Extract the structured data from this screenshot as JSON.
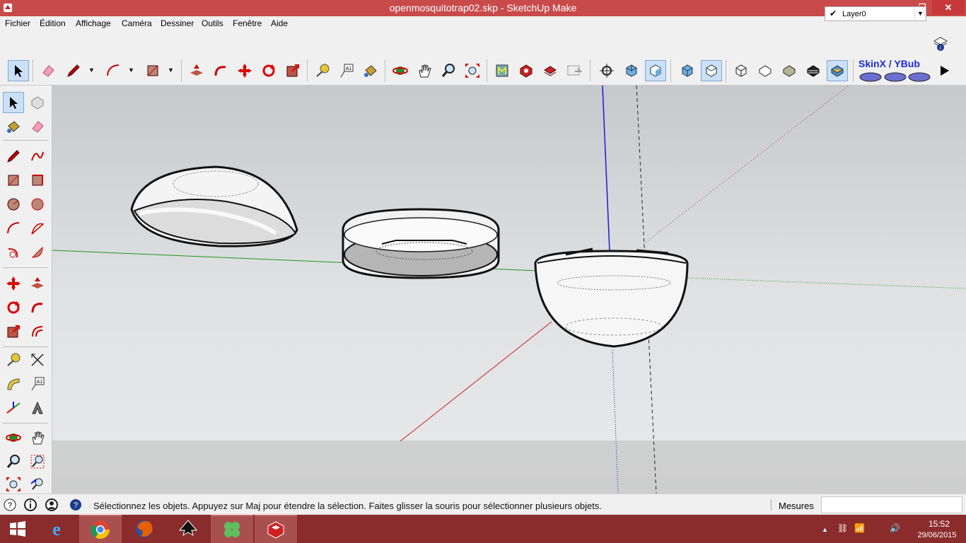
{
  "window": {
    "title": "openmosquitotrap02.skp - SketchUp Make",
    "controls": {
      "minimize": "—",
      "maximize": "❐",
      "close": "✕"
    }
  },
  "menu": [
    "Fichier",
    "Édition",
    "Affichage",
    "Caméra",
    "Dessiner",
    "Outils",
    "Fenêtre",
    "Aide"
  ],
  "layer": {
    "checked": "✔",
    "current": "Layer0"
  },
  "toolbar": {
    "plugin_label": "SkinX / YBub",
    "icons": [
      "select-icon",
      "eraser-icon",
      "pencil-icon",
      "arc-icon",
      "rectangle-icon",
      "push-pull-icon",
      "follow-me-icon",
      "move-icon",
      "rotate-icon",
      "scale-icon",
      "tape-measure-icon",
      "text-label-icon",
      "paint-bucket-icon",
      "orbit-icon",
      "pan-icon",
      "zoom-icon",
      "zoom-extents-icon",
      "warehouse-icon",
      "extension-icon",
      "model-share-icon",
      "preview-icon",
      "position-camera-icon",
      "walk-icon",
      "look-around-icon",
      "iso-view-icon",
      "top-view-icon",
      "xray-icon",
      "wireframe-icon",
      "hidden-line-icon",
      "shaded-icon",
      "shaded-textures-icon",
      "monochrome-icon",
      "skinx-icon",
      "ybub-icon",
      "play-icon"
    ]
  },
  "status": {
    "message": "Sélectionnez les objets. Appuyez sur Maj pour étendre la sélection. Faites glisser la souris pour sélectionner plusieurs objets.",
    "measures_label": "Mesures",
    "measures_value": ""
  },
  "taskbar": {
    "apps": [
      "start-button",
      "internet-explorer-icon",
      "chrome-icon",
      "firefox-icon",
      "inkscape-icon",
      "clover-icon",
      "sketchup-icon"
    ],
    "time": "15:52",
    "date": "29/06/2015",
    "tray": [
      "▲",
      "⛓",
      "📶",
      "🔊"
    ]
  },
  "colors": {
    "titlebar": "#c94a4a",
    "taskbar": "#8a2c2c",
    "axis_red": "#d11b1b",
    "axis_green": "#1a9b1a",
    "axis_blue": "#1a1ad1",
    "plugin_text": "#1a2bd8"
  }
}
